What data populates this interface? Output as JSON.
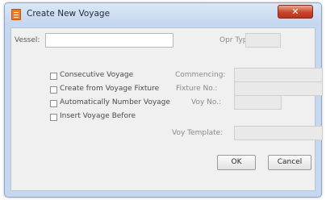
{
  "window": {
    "title": "Create New Voyage",
    "close_label": "✕"
  },
  "form": {
    "vessel_label": "Vessel:",
    "vessel_value": "",
    "opr_type_label": "Opr Type:",
    "opr_type_value": "",
    "commencing_label": "Commencing:",
    "commencing_value": "",
    "fixture_no_label": "Fixture No.:",
    "fixture_no_value": "",
    "voy_no_label": "Voy No.:",
    "voy_no_value": "",
    "voy_template_label": "Voy Template:",
    "voy_template_value": ""
  },
  "options": {
    "consecutive_voyage": "Consecutive Voyage",
    "create_from_fixture": "Create from Voyage Fixture",
    "auto_number": "Automatically Number Voyage",
    "insert_before": "Insert Voyage Before"
  },
  "buttons": {
    "ok": "OK",
    "cancel": "Cancel"
  },
  "colors": {
    "frame": "#c6d8ef",
    "content": "#f0f0f0",
    "close": "#c8452c"
  }
}
